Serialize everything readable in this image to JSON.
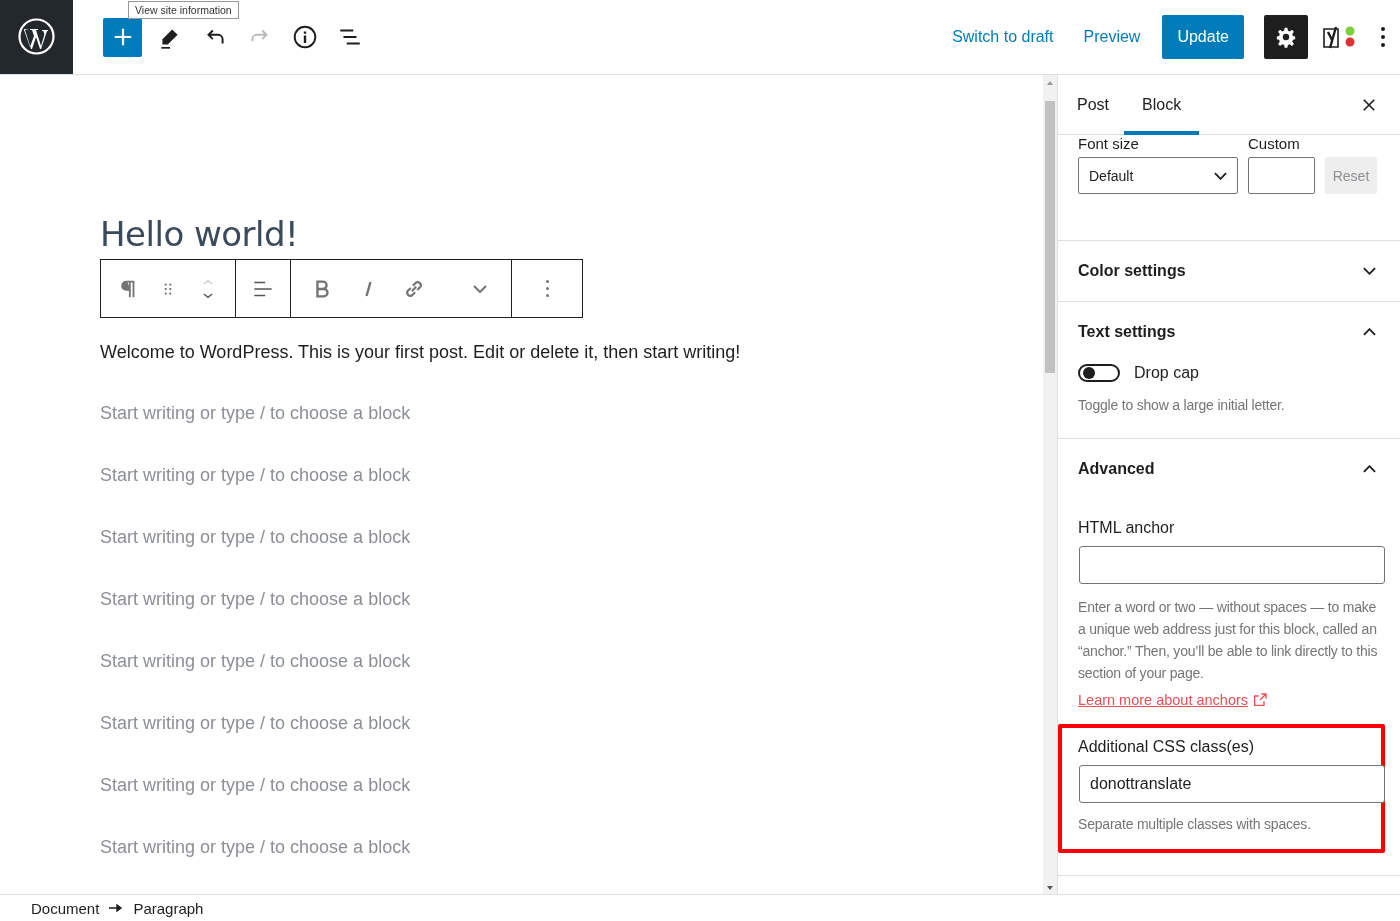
{
  "top_bar": {
    "tooltip": "View site information",
    "actions": [
      {
        "kind": "link",
        "label": "Switch to draft"
      },
      {
        "kind": "link",
        "label": "Preview"
      },
      {
        "kind": "primary",
        "label": "Update"
      }
    ],
    "settings_pressed": true
  },
  "editor": {
    "title": "Hello world!",
    "paragraph": "Welcome to WordPress. This is your first post. Edit or delete it, then start writing!",
    "placeholders": [
      "Start writing or type / to choose a block",
      "Start writing or type / to choose a block",
      "Start writing or type / to choose a block",
      "Start writing or type / to choose a block",
      "Start writing or type / to choose a block",
      "Start writing or type / to choose a block",
      "Start writing or type / to choose a block",
      "Start writing or type / to choose a block"
    ]
  },
  "sidebar": {
    "tabs": [
      {
        "label": "Post",
        "selected": false
      },
      {
        "label": "Block",
        "selected": true
      }
    ],
    "font_size": {
      "label": "Font size",
      "select_value": "Default",
      "custom_label": "Custom",
      "reset": {
        "label": "Reset",
        "disabled": true
      }
    },
    "panels": [
      {
        "title": "Color settings",
        "expanded": false
      },
      {
        "title": "Text settings",
        "expanded": true,
        "toggle": {
          "label": "Drop cap",
          "on": false
        },
        "help": "Toggle to show a large initial letter."
      },
      {
        "title": "Advanced",
        "expanded": true,
        "anchor_label": "HTML anchor",
        "anchor_help": "Enter a word or two — without spaces — to make a unique web address just for this block, called an “anchor.” Then, you’ll be able to link directly to this section of your page.",
        "anchor_link": "Learn more about anchors",
        "css_label": "Additional CSS class(es)",
        "css_value": "donottranslate",
        "css_help": "Separate multiple classes with spaces.",
        "css_highlighted": true
      }
    ]
  },
  "breadcrumbs": [
    "Document",
    "Paragraph"
  ]
}
